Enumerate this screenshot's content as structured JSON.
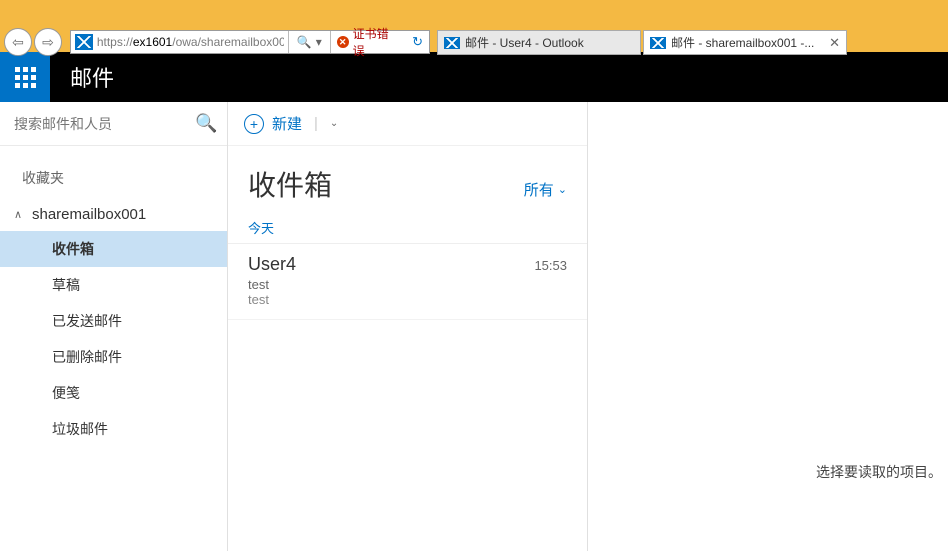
{
  "browser": {
    "url_full": "https://ex1601/owa/sharemailbox00",
    "url_scheme": "https://",
    "url_host": "ex1601",
    "url_path": "/owa/sharemailbox00",
    "cert_error": "证书错误",
    "tabs": [
      {
        "label": "邮件 - User4 - Outlook",
        "active": false
      },
      {
        "label": "邮件 - sharemailbox001 -...",
        "active": true
      }
    ]
  },
  "header": {
    "app_title": "邮件"
  },
  "sidebar": {
    "search_placeholder": "搜索邮件和人员",
    "favorites_label": "收藏夹",
    "mailbox_name": "sharemailbox001",
    "folders": [
      {
        "label": "收件箱",
        "selected": true
      },
      {
        "label": "草稿"
      },
      {
        "label": "已发送邮件"
      },
      {
        "label": "已删除邮件"
      },
      {
        "label": "便笺"
      },
      {
        "label": "垃圾邮件"
      }
    ]
  },
  "toolbar": {
    "new_label": "新建"
  },
  "list": {
    "folder_title": "收件箱",
    "filter_label": "所有",
    "groups": [
      {
        "label": "今天",
        "messages": [
          {
            "from": "User4",
            "subject": "test",
            "preview": "test",
            "time": "15:53"
          }
        ]
      }
    ]
  },
  "reader": {
    "empty_text": "选择要读取的项目。"
  }
}
